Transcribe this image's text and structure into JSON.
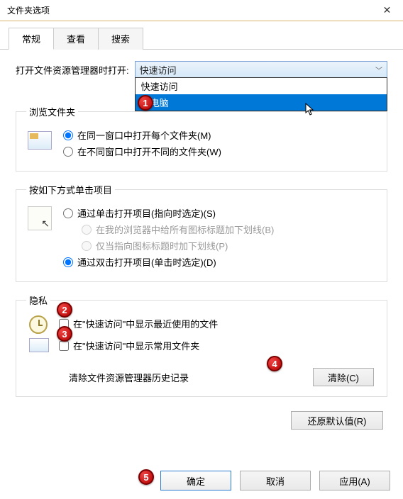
{
  "window": {
    "title": "文件夹选项"
  },
  "tabs": {
    "t0": "常规",
    "t1": "查看",
    "t2": "搜索"
  },
  "open": {
    "label": "打开文件资源管理器时打开:",
    "selected": "快速访问",
    "options": {
      "o0": "快速访问",
      "o1": "此电脑"
    }
  },
  "browse": {
    "legend": "浏览文件夹",
    "r0": "在同一窗口中打开每个文件夹(M)",
    "r1": "在不同窗口中打开不同的文件夹(W)"
  },
  "click": {
    "legend": "按如下方式单击项目",
    "r0": "通过单击打开项目(指向时选定)(S)",
    "s0": "在我的浏览器中给所有图标标题加下划线(B)",
    "s1": "仅当指向图标标题时加下划线(P)",
    "r1": "通过双击打开项目(单击时选定)(D)"
  },
  "privacy": {
    "legend": "隐私",
    "c0": "在\"快速访问\"中显示最近使用的文件",
    "c1": "在\"快速访问\"中显示常用文件夹",
    "clearLabel": "清除文件资源管理器历史记录",
    "clearBtn": "清除(C)"
  },
  "restoreBtn": "还原默认值(R)",
  "footer": {
    "ok": "确定",
    "cancel": "取消",
    "apply": "应用(A)"
  },
  "badges": {
    "b1": "1",
    "b2": "2",
    "b3": "3",
    "b4": "4",
    "b5": "5"
  }
}
